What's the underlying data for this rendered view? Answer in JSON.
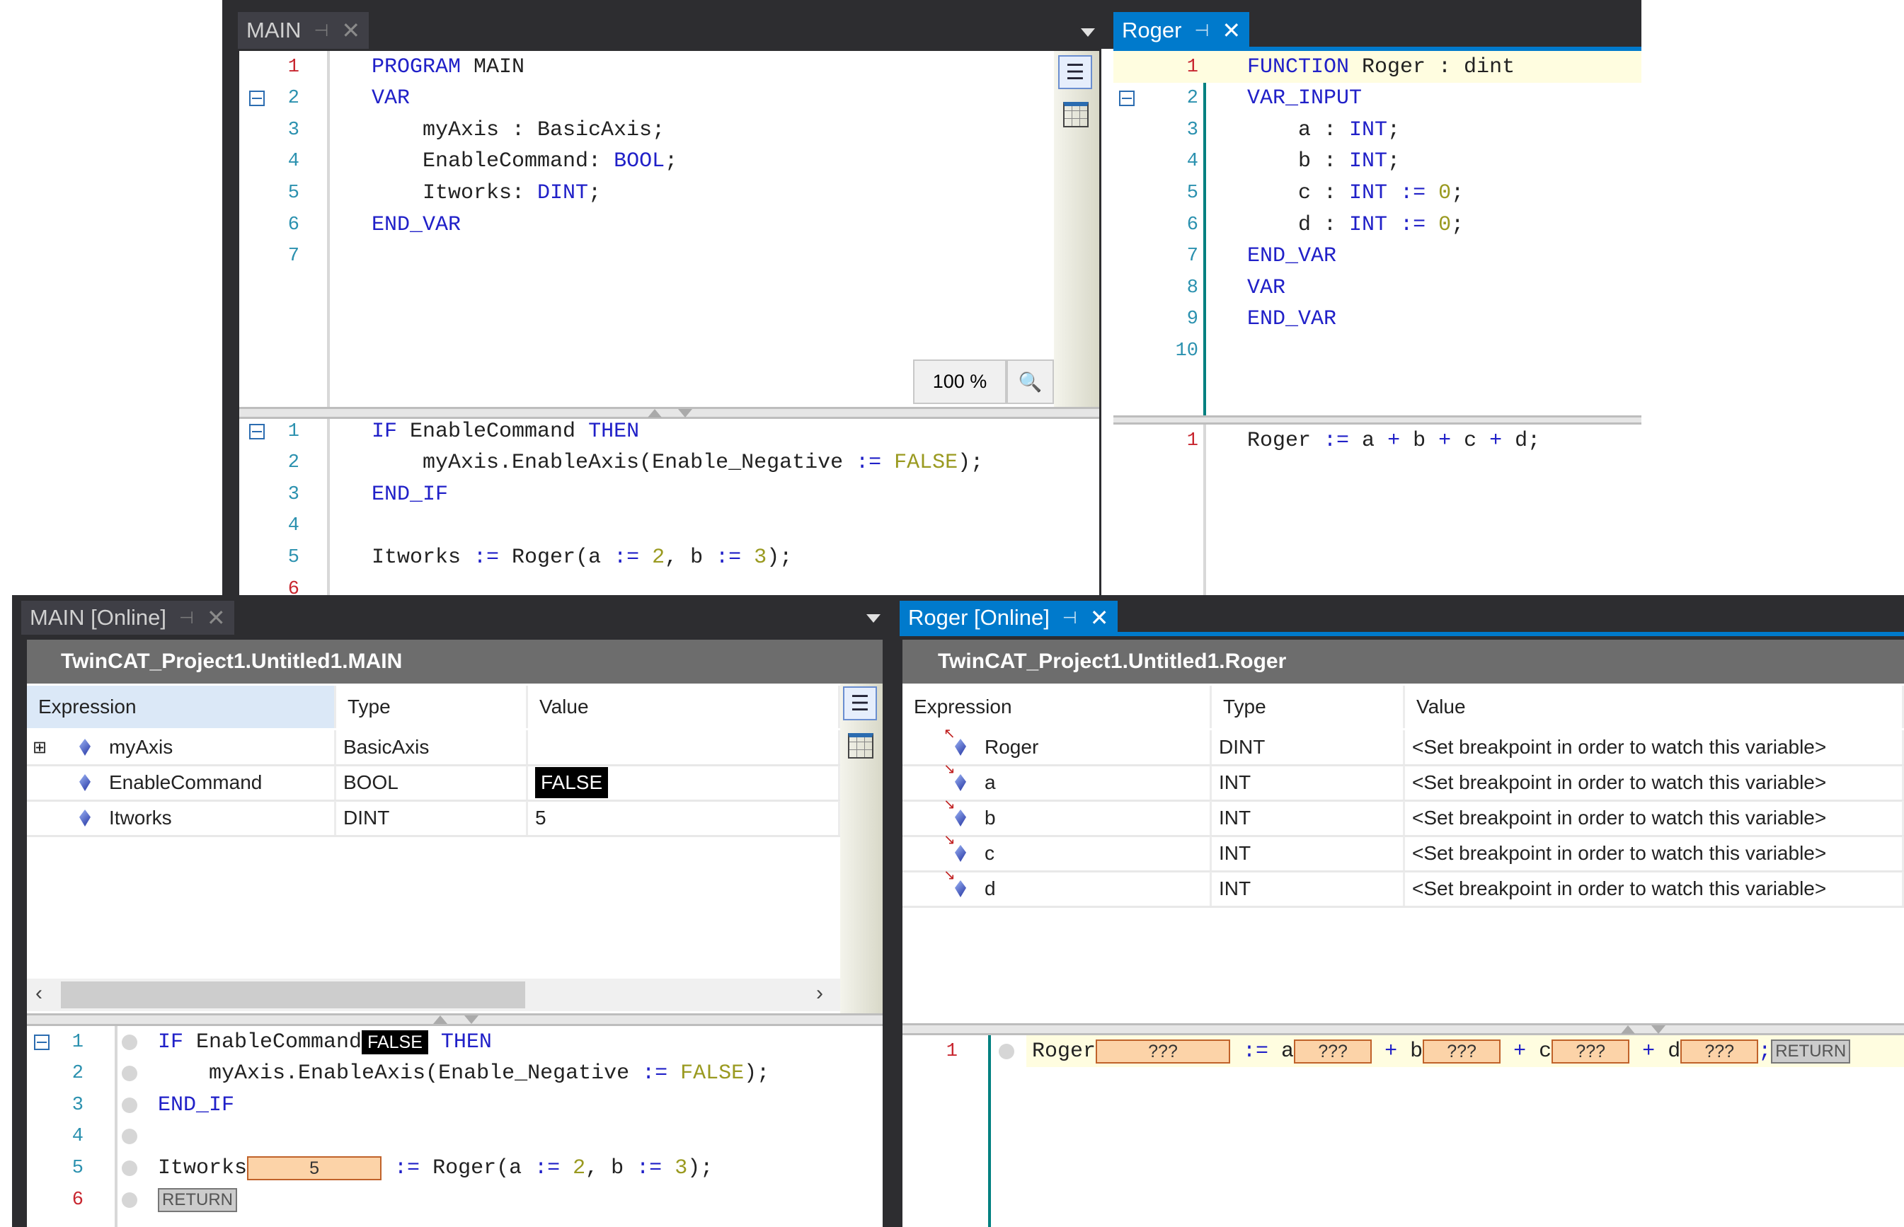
{
  "colors": {
    "accent": "#007acc",
    "frame": "#2d2d30",
    "keyword": "#2020c8",
    "number": "#9a9a20",
    "watch_box": "#fcd3a8",
    "header_bar": "#6d6d6d"
  },
  "main_editor": {
    "tab": {
      "label": "MAIN",
      "pin_icon": "pin-icon",
      "close_icon": "close-icon"
    },
    "zoom": "100 %",
    "decl_lines": [
      {
        "n": "1",
        "red": true,
        "tokens": [
          {
            "t": "PROGRAM",
            "k": "kw"
          },
          {
            "t": " MAIN",
            "k": "id"
          }
        ]
      },
      {
        "n": "2",
        "fold": true,
        "tokens": [
          {
            "t": "VAR",
            "k": "kw"
          }
        ]
      },
      {
        "n": "3",
        "tokens": [
          {
            "t": "    myAxis : BasicAxis;",
            "k": "id"
          }
        ]
      },
      {
        "n": "4",
        "tokens": [
          {
            "t": "    EnableCommand: ",
            "k": "id"
          },
          {
            "t": "BOOL",
            "k": "kw"
          },
          {
            "t": ";",
            "k": "id"
          }
        ]
      },
      {
        "n": "5",
        "tokens": [
          {
            "t": "    Itworks: ",
            "k": "id"
          },
          {
            "t": "DINT",
            "k": "kw"
          },
          {
            "t": ";",
            "k": "id"
          }
        ]
      },
      {
        "n": "6",
        "tokens": [
          {
            "t": "END_VAR",
            "k": "kw"
          }
        ]
      },
      {
        "n": "7",
        "tokens": []
      }
    ],
    "impl_lines": [
      {
        "n": "1",
        "fold": true,
        "tokens": [
          {
            "t": "IF",
            "k": "kw"
          },
          {
            "t": " EnableCommand ",
            "k": "id"
          },
          {
            "t": "THEN",
            "k": "kw"
          }
        ]
      },
      {
        "n": "2",
        "tokens": [
          {
            "t": "    myAxis.EnableAxis(Enable_Negative ",
            "k": "id"
          },
          {
            "t": ":=",
            "k": "op"
          },
          {
            "t": " ",
            "k": "id"
          },
          {
            "t": "FALSE",
            "k": "num"
          },
          {
            "t": ");",
            "k": "id"
          }
        ]
      },
      {
        "n": "3",
        "tokens": [
          {
            "t": "END_IF",
            "k": "kw"
          }
        ]
      },
      {
        "n": "4",
        "tokens": []
      },
      {
        "n": "5",
        "tokens": [
          {
            "t": "Itworks ",
            "k": "id"
          },
          {
            "t": ":=",
            "k": "op"
          },
          {
            "t": " Roger(a ",
            "k": "id"
          },
          {
            "t": ":=",
            "k": "op"
          },
          {
            "t": " ",
            "k": "id"
          },
          {
            "t": "2",
            "k": "num"
          },
          {
            "t": ", b ",
            "k": "id"
          },
          {
            "t": ":=",
            "k": "op"
          },
          {
            "t": " ",
            "k": "id"
          },
          {
            "t": "3",
            "k": "num"
          },
          {
            "t": ");",
            "k": "id"
          }
        ]
      },
      {
        "n": "6",
        "red": true,
        "tokens": []
      }
    ]
  },
  "roger_editor": {
    "tab": {
      "label": "Roger",
      "pin_icon": "pin-icon",
      "close_icon": "close-icon"
    },
    "decl_lines": [
      {
        "n": "1",
        "red": true,
        "hl": true,
        "tokens": [
          {
            "t": "FUNCTION",
            "k": "kw"
          },
          {
            "t": " Roger : dint",
            "k": "id"
          }
        ]
      },
      {
        "n": "2",
        "fold": true,
        "tokens": [
          {
            "t": "VAR_INPUT",
            "k": "kw"
          }
        ]
      },
      {
        "n": "3",
        "tokens": [
          {
            "t": "    a : ",
            "k": "id"
          },
          {
            "t": "INT",
            "k": "kw"
          },
          {
            "t": ";",
            "k": "id"
          }
        ]
      },
      {
        "n": "4",
        "tokens": [
          {
            "t": "    b : ",
            "k": "id"
          },
          {
            "t": "INT",
            "k": "kw"
          },
          {
            "t": ";",
            "k": "id"
          }
        ]
      },
      {
        "n": "5",
        "tokens": [
          {
            "t": "    c : ",
            "k": "id"
          },
          {
            "t": "INT",
            "k": "kw"
          },
          {
            "t": " ",
            "k": "id"
          },
          {
            "t": ":=",
            "k": "op"
          },
          {
            "t": " ",
            "k": "id"
          },
          {
            "t": "0",
            "k": "num"
          },
          {
            "t": ";",
            "k": "id"
          }
        ]
      },
      {
        "n": "6",
        "tokens": [
          {
            "t": "    d : ",
            "k": "id"
          },
          {
            "t": "INT",
            "k": "kw"
          },
          {
            "t": " ",
            "k": "id"
          },
          {
            "t": ":=",
            "k": "op"
          },
          {
            "t": " ",
            "k": "id"
          },
          {
            "t": "0",
            "k": "num"
          },
          {
            "t": ";",
            "k": "id"
          }
        ]
      },
      {
        "n": "7",
        "tokens": [
          {
            "t": "END_VAR",
            "k": "kw"
          }
        ]
      },
      {
        "n": "8",
        "tokens": [
          {
            "t": "VAR",
            "k": "kw"
          }
        ]
      },
      {
        "n": "9",
        "tokens": [
          {
            "t": "END_VAR",
            "k": "kw"
          }
        ]
      },
      {
        "n": "10",
        "tokens": []
      }
    ],
    "impl_lines": [
      {
        "n": "1",
        "red": true,
        "tokens": [
          {
            "t": "Roger ",
            "k": "id"
          },
          {
            "t": ":=",
            "k": "op"
          },
          {
            "t": " a ",
            "k": "id"
          },
          {
            "t": "+",
            "k": "op"
          },
          {
            "t": " b ",
            "k": "id"
          },
          {
            "t": "+",
            "k": "op"
          },
          {
            "t": " c ",
            "k": "id"
          },
          {
            "t": "+",
            "k": "op"
          },
          {
            "t": " d;",
            "k": "id"
          }
        ]
      }
    ]
  },
  "main_online": {
    "tab": {
      "label": "MAIN [Online]",
      "pin_icon": "pin-icon",
      "close_icon": "close-icon"
    },
    "path": "TwinCAT_Project1.Untitled1.MAIN",
    "columns": [
      "Expression",
      "Type",
      "Value"
    ],
    "rows": [
      {
        "expr": "myAxis",
        "type": "BasicAxis",
        "value": "",
        "expandable": true
      },
      {
        "expr": "EnableCommand",
        "type": "BOOL",
        "value": "FALSE",
        "bool": true
      },
      {
        "expr": "Itworks",
        "type": "DINT",
        "value": "5"
      }
    ],
    "code_lines": [
      {
        "n": "1",
        "fold": true,
        "tokens": [
          {
            "t": "IF",
            "k": "kw"
          },
          {
            "t": " EnableCommand",
            "k": "id"
          },
          {
            "t": "FALSE",
            "k": "wbool"
          },
          {
            "t": " ",
            "k": "id"
          },
          {
            "t": "THEN",
            "k": "kw"
          }
        ]
      },
      {
        "n": "2",
        "tokens": [
          {
            "t": "    myAxis.EnableAxis(Enable_Negative ",
            "k": "id"
          },
          {
            "t": ":=",
            "k": "op"
          },
          {
            "t": " ",
            "k": "id"
          },
          {
            "t": "FALSE",
            "k": "num"
          },
          {
            "t": ");",
            "k": "id"
          }
        ]
      },
      {
        "n": "3",
        "tokens": [
          {
            "t": "END_IF",
            "k": "kw"
          }
        ]
      },
      {
        "n": "4",
        "tokens": []
      },
      {
        "n": "5",
        "tokens": [
          {
            "t": "Itworks",
            "k": "id"
          },
          {
            "t": "5",
            "k": "watch",
            "w": 190
          },
          {
            "t": " ",
            "k": "id"
          },
          {
            "t": ":=",
            "k": "op"
          },
          {
            "t": " Roger(a ",
            "k": "id"
          },
          {
            "t": ":=",
            "k": "op"
          },
          {
            "t": " ",
            "k": "id"
          },
          {
            "t": "2",
            "k": "num"
          },
          {
            "t": ", b ",
            "k": "id"
          },
          {
            "t": ":=",
            "k": "op"
          },
          {
            "t": " ",
            "k": "id"
          },
          {
            "t": "3",
            "k": "num"
          },
          {
            "t": ");",
            "k": "id"
          }
        ]
      },
      {
        "n": "6",
        "red": true,
        "tokens": [
          {
            "t": "RETURN",
            "k": "ret"
          }
        ]
      }
    ]
  },
  "roger_online": {
    "tab": {
      "label": "Roger [Online]",
      "pin_icon": "pin-icon",
      "close_icon": "close-icon"
    },
    "path": "TwinCAT_Project1.Untitled1.Roger",
    "columns": [
      "Expression",
      "Type",
      "Value"
    ],
    "rows": [
      {
        "expr": "Roger",
        "type": "DINT",
        "value": "<Set breakpoint in order to watch this variable>",
        "output": true
      },
      {
        "expr": "a",
        "type": "INT",
        "value": "<Set breakpoint in order to watch this variable>"
      },
      {
        "expr": "b",
        "type": "INT",
        "value": "<Set breakpoint in order to watch this variable>"
      },
      {
        "expr": "c",
        "type": "INT",
        "value": "<Set breakpoint in order to watch this variable>"
      },
      {
        "expr": "d",
        "type": "INT",
        "value": "<Set breakpoint in order to watch this variable>"
      }
    ],
    "code_lines": [
      {
        "n": "1",
        "red": true,
        "hl": true,
        "tokens": [
          {
            "t": "Roger",
            "k": "id"
          },
          {
            "t": "???",
            "k": "watch",
            "w": 190
          },
          {
            "t": " ",
            "k": "id"
          },
          {
            "t": ":=",
            "k": "op"
          },
          {
            "t": " a",
            "k": "id"
          },
          {
            "t": "???",
            "k": "watch",
            "w": 110
          },
          {
            "t": " ",
            "k": "id"
          },
          {
            "t": "+",
            "k": "op"
          },
          {
            "t": " b",
            "k": "id"
          },
          {
            "t": "???",
            "k": "watch",
            "w": 110
          },
          {
            "t": " ",
            "k": "id"
          },
          {
            "t": "+",
            "k": "op"
          },
          {
            "t": " c",
            "k": "id"
          },
          {
            "t": "???",
            "k": "watch",
            "w": 110
          },
          {
            "t": " ",
            "k": "id"
          },
          {
            "t": "+",
            "k": "op"
          },
          {
            "t": " d",
            "k": "id"
          },
          {
            "t": "???",
            "k": "watch",
            "w": 110
          },
          {
            "t": ";",
            "k": "op"
          },
          {
            "t": "RETURN",
            "k": "ret"
          }
        ]
      }
    ]
  }
}
